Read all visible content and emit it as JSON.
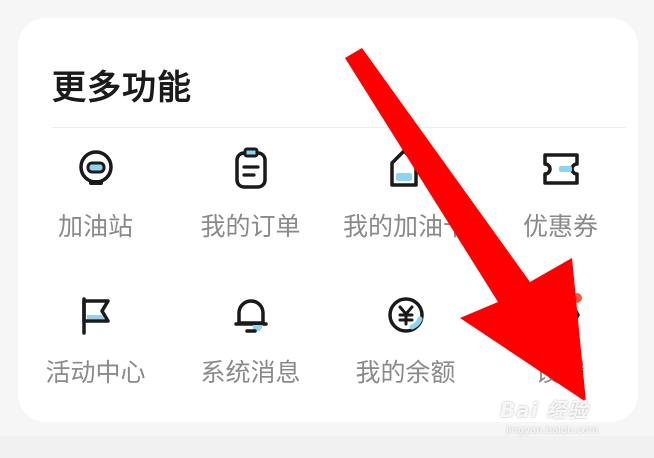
{
  "section": {
    "title": "更多功能"
  },
  "items": [
    {
      "label": "加油站",
      "icon": "gas-station-icon"
    },
    {
      "label": "我的订单",
      "icon": "order-clipboard-icon"
    },
    {
      "label": "我的加油卡",
      "icon": "fuel-card-icon"
    },
    {
      "label": "优惠券",
      "icon": "coupon-icon"
    },
    {
      "label": "活动中心",
      "icon": "flag-icon"
    },
    {
      "label": "系统消息",
      "icon": "bell-icon"
    },
    {
      "label": "我的余额",
      "icon": "yuan-coin-icon"
    },
    {
      "label": "设置",
      "icon": "settings-hex-icon"
    }
  ],
  "settings_badge_color": "#f05a3c",
  "accent_color": "#8fd3f4",
  "arrow_color": "#ff0000",
  "watermark": {
    "main": "Bai 经验",
    "sub": "jingyan.baidu.com"
  }
}
